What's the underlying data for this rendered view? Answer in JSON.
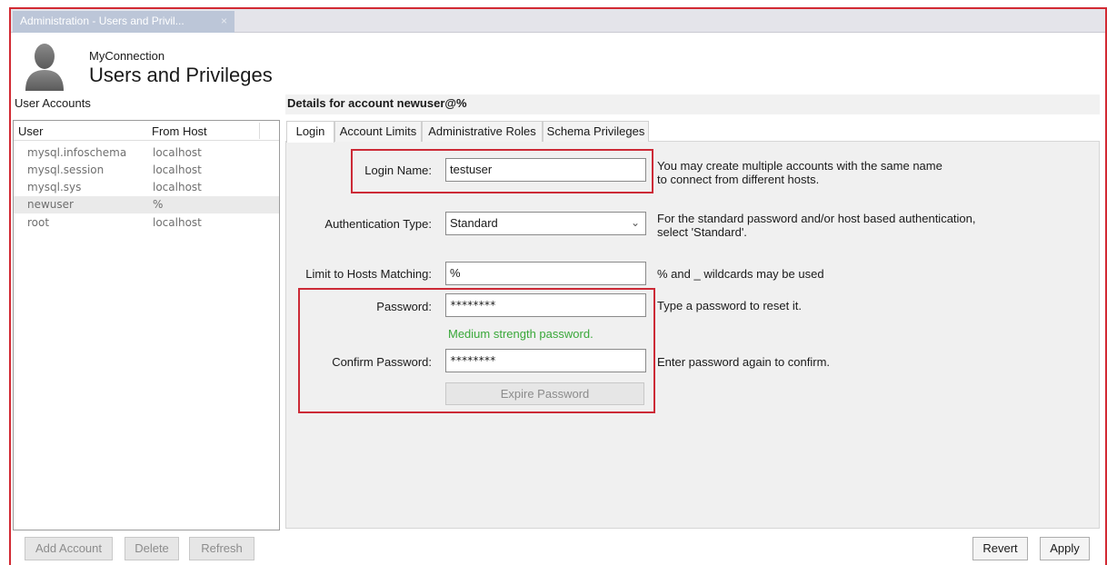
{
  "window": {
    "tab_title": "Administration - Users and Privil...",
    "tab_close": "×"
  },
  "header": {
    "connection": "MyConnection",
    "title": "Users and Privileges",
    "icon": "user-silhouette-icon"
  },
  "accounts": {
    "label": "User Accounts",
    "columns": [
      "User",
      "From Host"
    ],
    "rows": [
      {
        "user": "mysql.infoschema",
        "host": "localhost"
      },
      {
        "user": "mysql.session",
        "host": "localhost"
      },
      {
        "user": "mysql.sys",
        "host": "localhost"
      },
      {
        "user": "newuser",
        "host": "%"
      },
      {
        "user": "root",
        "host": "localhost"
      }
    ],
    "selected_index": 3,
    "buttons": {
      "add": "Add Account",
      "delete": "Delete",
      "refresh": "Refresh"
    }
  },
  "details": {
    "title": "Details for account newuser@%",
    "tabs": [
      "Login",
      "Account Limits",
      "Administrative Roles",
      "Schema Privileges"
    ],
    "active_tab": "Login",
    "login_name": {
      "label": "Login Name:",
      "value": "testuser",
      "help1": "You may create multiple accounts with the same name",
      "help2": "to connect from different hosts."
    },
    "auth_type": {
      "label": "Authentication Type:",
      "value": "Standard",
      "help1": "For the standard password and/or host based authentication,",
      "help2": "select 'Standard'."
    },
    "hosts": {
      "label": "Limit to Hosts Matching:",
      "value": "%",
      "help": "% and _ wildcards may be used"
    },
    "password": {
      "label": "Password:",
      "value": "********",
      "help": "Type a password to reset it.",
      "strength": "Medium strength password."
    },
    "confirm": {
      "label": "Confirm Password:",
      "value": "********",
      "help": "Enter password again to confirm."
    },
    "expire_button": "Expire Password"
  },
  "footer": {
    "revert": "Revert",
    "apply": "Apply"
  },
  "colors": {
    "highlight": "#cc2a36",
    "strength_text": "#3aa83a",
    "tab_bg": "#bcc6d8"
  }
}
